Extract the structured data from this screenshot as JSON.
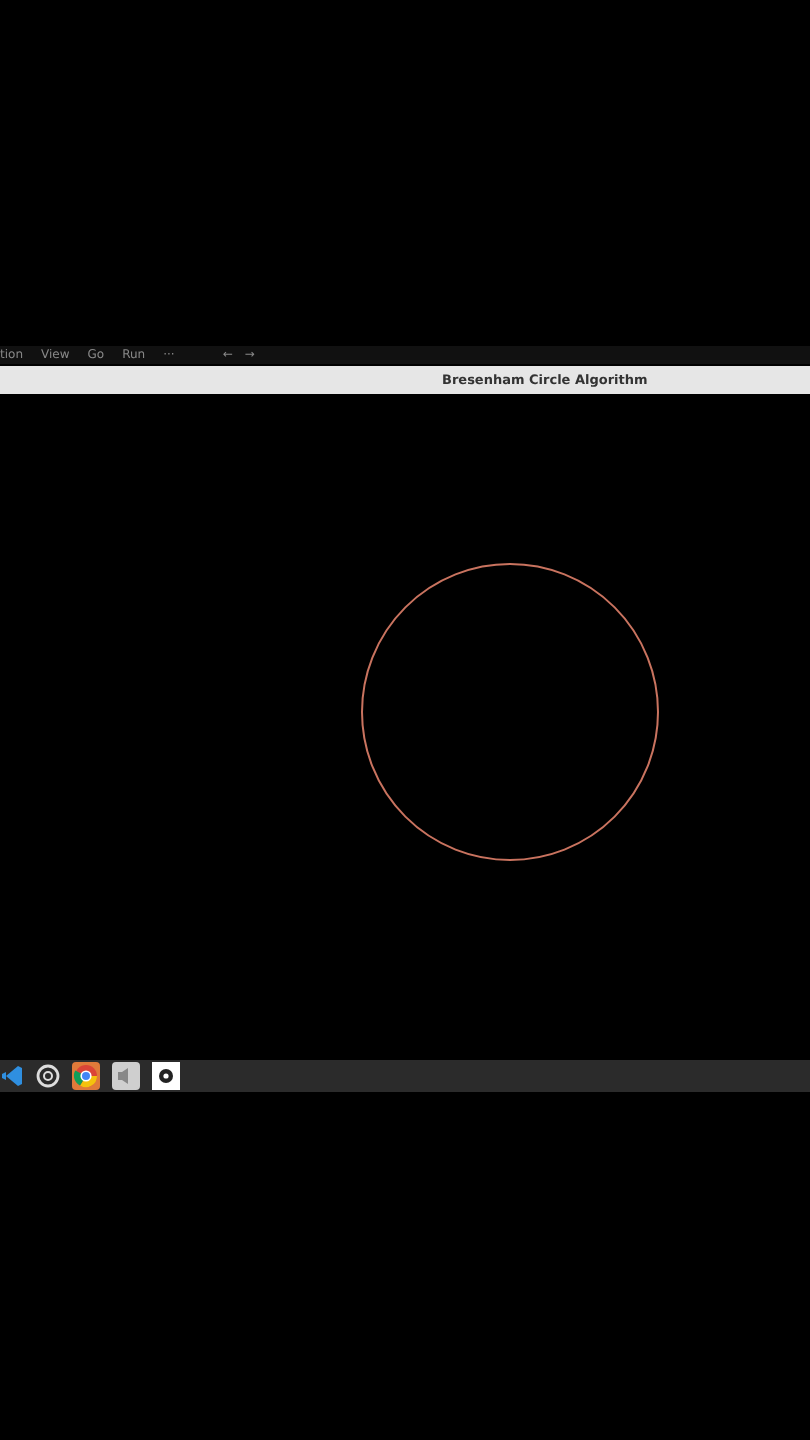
{
  "menu_bar": {
    "items": [
      "tion",
      "View",
      "Go",
      "Run",
      "···"
    ],
    "nav": [
      "←",
      "→"
    ]
  },
  "window": {
    "title": "Bresenham Circle Algorithm"
  },
  "taskbar": {
    "apps": [
      {
        "kind": "code"
      },
      {
        "kind": "aperture"
      },
      {
        "kind": "browser"
      },
      {
        "kind": "terminal"
      },
      {
        "kind": "settings"
      }
    ]
  }
}
